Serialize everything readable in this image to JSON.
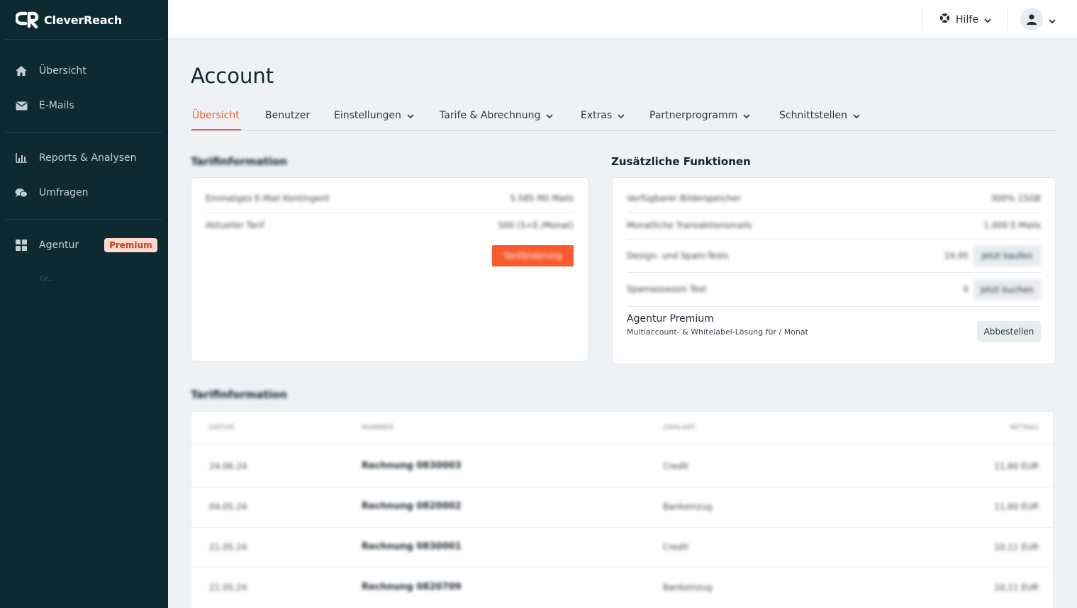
{
  "app": {
    "brand": "CleverReach"
  },
  "sidebar": {
    "items": [
      {
        "label": "Übersicht",
        "icon": "home-icon"
      },
      {
        "label": "E-Mails",
        "icon": "envelope-icon"
      },
      {
        "label": "Reports & Analysen",
        "icon": "bar-chart-icon"
      },
      {
        "label": "Umfragen",
        "icon": "chat-bubbles-icon"
      },
      {
        "label": "Agentur",
        "icon": "grid-icon",
        "badge": "Premium"
      }
    ],
    "faded_item": "Gr..."
  },
  "topbar": {
    "help_label": "Hilfe"
  },
  "page": {
    "title": "Account"
  },
  "tabs": [
    {
      "label": "Übersicht",
      "active": true,
      "dropdown": false
    },
    {
      "label": "Benutzer",
      "active": false,
      "dropdown": false
    },
    {
      "label": "Einstellungen",
      "active": false,
      "dropdown": true
    },
    {
      "label": "Tarife & Abrechnung",
      "active": false,
      "dropdown": true
    },
    {
      "label": "Extras",
      "active": false,
      "dropdown": true
    },
    {
      "label": "Partnerprogramm",
      "active": false,
      "dropdown": true
    },
    {
      "label": "Schnittstellen",
      "active": false,
      "dropdown": true
    }
  ],
  "tarif": {
    "title": "Tarifinformation",
    "rows": [
      {
        "label": "Einmaliges E-Mail Kontingent",
        "value": "5.585 Mil Mails"
      },
      {
        "label": "Aktueller Tarif",
        "value": "500 (5+E./Monat)"
      }
    ],
    "button": "Tarifänderung"
  },
  "extras": {
    "title": "Zusätzliche Funktionen",
    "rows": [
      {
        "label": "Verfügbarer Bilderspeicher",
        "value": "300% 15GB",
        "button": ""
      },
      {
        "label": "Monatliche Transaktionsmails",
        "value": "1.000 E-Mails",
        "button": ""
      },
      {
        "label": "Design- und Spam-Tests",
        "value": "19,95",
        "button": "Jetzt kaufen"
      },
      {
        "label": "Spamassassin Test",
        "value": "0",
        "button": "Jetzt buchen"
      }
    ],
    "premium": {
      "title": "Agentur Premium",
      "subtitle": "Multiaccount- & Whitelabel-Lösung für / Monat",
      "button": "Abbestellen"
    }
  },
  "invoices": {
    "title": "Tarifinformation",
    "headers": [
      "Datum",
      "Nummer",
      "Zahlart",
      "Betrag"
    ],
    "rows": [
      {
        "date": "24.06.24",
        "number": "Rechnung 0830003",
        "method": "Credit",
        "amount": "11,60 EUR"
      },
      {
        "date": "04.05.24",
        "number": "Rechnung 0820002",
        "method": "Bankeinzug",
        "amount": "11,60 EUR"
      },
      {
        "date": "21.05.24",
        "number": "Rechnung 0830001",
        "method": "Credit",
        "amount": "10,11 EUR"
      },
      {
        "date": "21.05.24",
        "number": "Rechnung 0820709",
        "method": "Bankeinzug",
        "amount": "10,11 EUR"
      }
    ]
  },
  "colors": {
    "sidebar_bg": "#0d2a33",
    "accent": "#ea5a32",
    "badge_bg": "#ffd9cf"
  }
}
